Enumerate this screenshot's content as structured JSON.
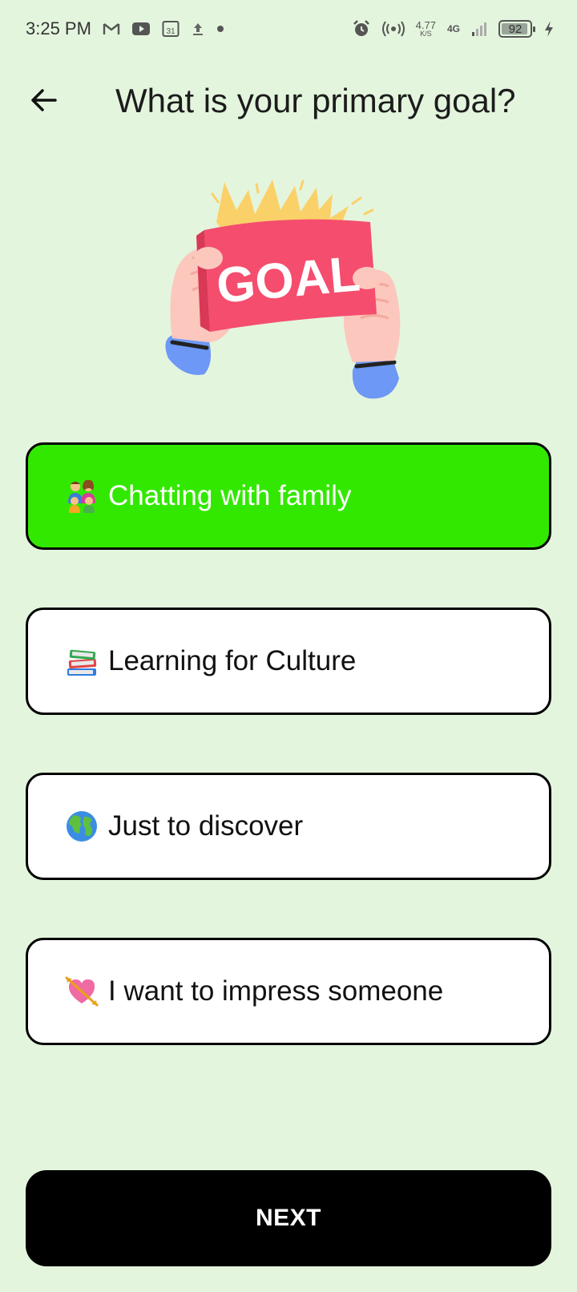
{
  "status_bar": {
    "time": "3:25 PM",
    "speed_value": "4.77",
    "speed_unit": "K/S",
    "network": "4G",
    "battery": "92",
    "calendar_day": "31",
    "icons": [
      "gmail-icon",
      "youtube-icon",
      "calendar-icon",
      "upload-icon",
      "dot-icon",
      "alarm-icon",
      "hotspot-icon",
      "signal-icon",
      "battery-icon",
      "charging-icon"
    ]
  },
  "header": {
    "title": "What is your primary goal?"
  },
  "illustration": {
    "text": "GOAL"
  },
  "options": [
    {
      "emoji": "family-icon",
      "label": "Chatting with family",
      "selected": true
    },
    {
      "emoji": "books-icon",
      "label": "Learning for Culture",
      "selected": false
    },
    {
      "emoji": "globe-icon",
      "label": "Just to discover",
      "selected": false
    },
    {
      "emoji": "heart-arrow-icon",
      "label": "I want to impress someone",
      "selected": false
    }
  ],
  "next_button": {
    "label": "NEXT"
  },
  "colors": {
    "background": "#e4f5de",
    "selected": "#33e800",
    "button": "#000000"
  }
}
